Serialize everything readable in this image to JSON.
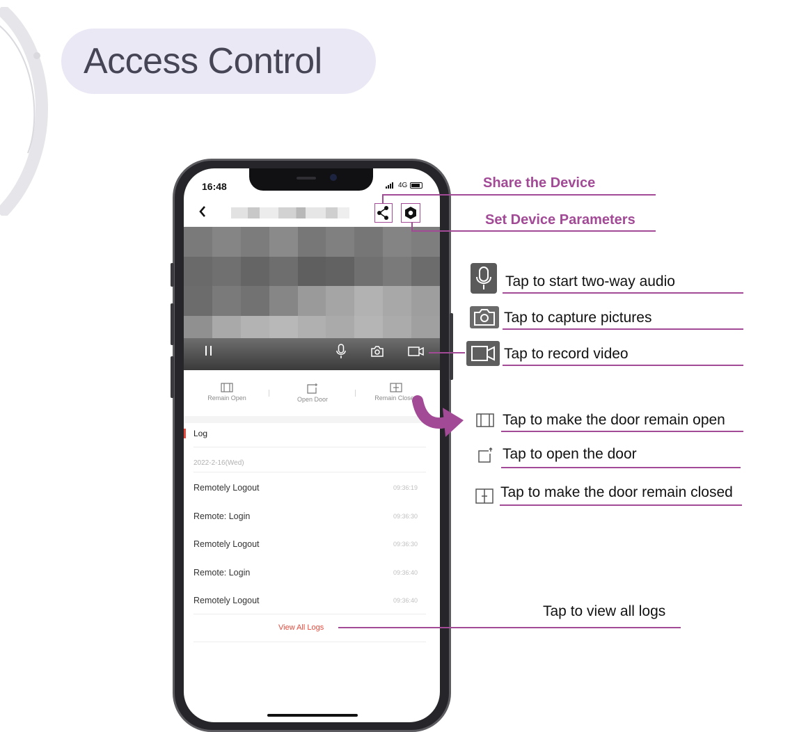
{
  "page_title": "Access Control",
  "phone": {
    "status": {
      "time": "16:48",
      "network": "4G"
    },
    "nav": {
      "back_icon": "chevron-left-icon",
      "share_icon": "share-icon",
      "settings_icon": "gear-icon"
    },
    "video_controls": {
      "pause_icon": "pause-icon",
      "mic_icon": "microphone-icon",
      "camera_icon": "camera-icon",
      "record_icon": "video-record-icon"
    },
    "door_controls": [
      {
        "label": "Remain Open",
        "icon": "door-open-icon"
      },
      {
        "label": "Open Door",
        "icon": "door-icon"
      },
      {
        "label": "Remain Closed",
        "icon": "door-closed-icon"
      }
    ],
    "log": {
      "tab_label": "Log",
      "date": "2022-2-16(Wed)",
      "entries": [
        {
          "event": "Remotely Logout",
          "time": "09:36:19"
        },
        {
          "event": "Remote: Login",
          "time": "09:36:30"
        },
        {
          "event": "Remotely Logout",
          "time": "09:36:30"
        },
        {
          "event": "Remote: Login",
          "time": "09:36:40"
        },
        {
          "event": "Remotely Logout",
          "time": "09:36:40"
        }
      ],
      "view_all_label": "View All Logs"
    }
  },
  "annotations": {
    "share": "Share the Device",
    "settings": "Set Device Parameters",
    "audio": "Tap to start two-way audio",
    "capture": "Tap to capture pictures",
    "record": "Tap to record video",
    "remain_open": "Tap to make the door remain open",
    "open_door": "Tap to open the door",
    "remain_closed": "Tap to make the door remain closed",
    "view_logs": "Tap to view all logs"
  },
  "colors": {
    "accent": "#a24a96",
    "log_red": "#e54a3c",
    "title_bg": "#ebe8f6",
    "title_text": "#454555"
  }
}
